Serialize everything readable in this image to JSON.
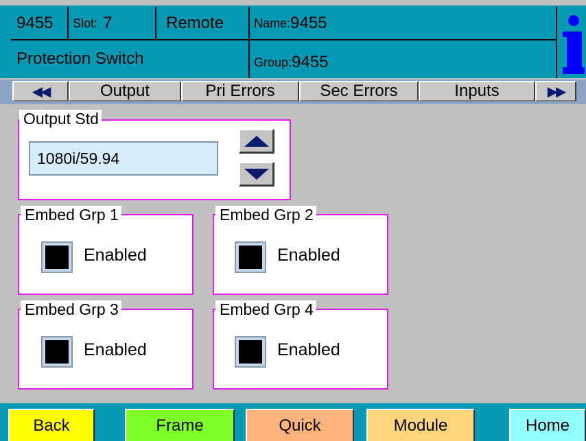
{
  "header": {
    "device_id": "9455",
    "slot_label": "Slot:",
    "slot_value": "7",
    "mode": "Remote",
    "name_label": "Name:",
    "name_value": "9455",
    "card_type": "Protection Switch",
    "group_label": "Group:",
    "group_value": "9455",
    "info_icon": "info-icon"
  },
  "tabs": {
    "prev_glyph": "◀◀",
    "next_glyph": "▶▶",
    "items": [
      "Output",
      "Pri Errors",
      "Sec Errors",
      "Inputs"
    ],
    "active": "Output"
  },
  "output_std": {
    "legend": "Output Std",
    "value": "1080i/59.94",
    "up_icon": "arrow-up-icon",
    "down_icon": "arrow-down-icon"
  },
  "embed_groups": [
    {
      "legend": "Embed Grp 1",
      "checkbox_label": "Enabled"
    },
    {
      "legend": "Embed Grp 2",
      "checkbox_label": "Enabled"
    },
    {
      "legend": "Embed Grp 3",
      "checkbox_label": "Enabled"
    },
    {
      "legend": "Embed Grp 4",
      "checkbox_label": "Enabled"
    }
  ],
  "bottom_buttons": {
    "back": "Back",
    "frame": "Frame",
    "quick": "Quick",
    "module": "Module",
    "home": "Home"
  },
  "colors": {
    "header_bg": "#0699b4",
    "panel_border": "#e01ee6",
    "back_bg": "#ffff00",
    "frame_bg": "#7eff2a",
    "quick_bg": "#ffb37c",
    "module_bg": "#ffd47f",
    "home_bg": "#92ffff"
  }
}
